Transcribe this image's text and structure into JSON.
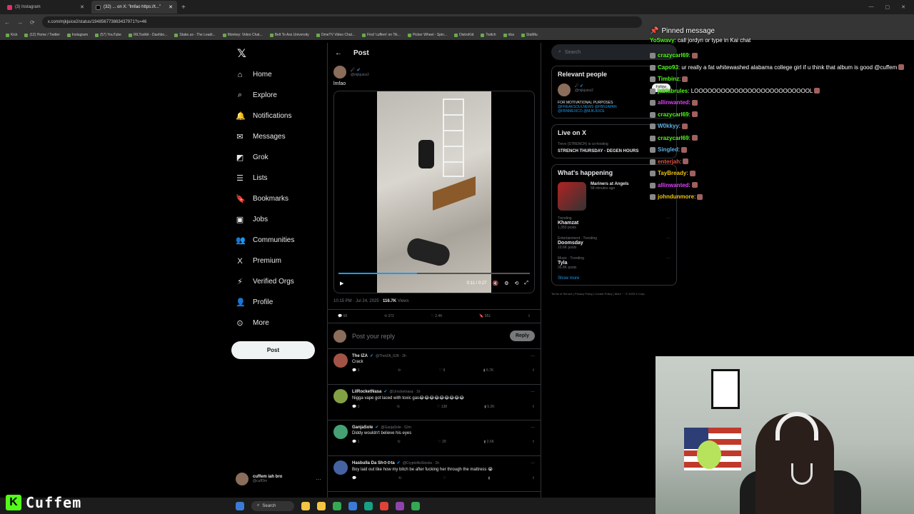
{
  "browser": {
    "tabs": [
      {
        "label": "(3) Instagram",
        "active": false
      },
      {
        "label": "(32) ... on X: \"lmfao https://t...\"",
        "active": true
      }
    ],
    "url": "x.com/mjkjuice2/status/194856773863437971?s=46",
    "bookmarks": [
      "Kick",
      "(12) Home / Twitter",
      "Instagram",
      "(57) YouTube",
      "IRLToolkit - Dashbo...",
      "Stake.us - The Leadi...",
      "Monkey: Video Chat...",
      "Belt To Ass University",
      "OmeTV Video Chat...",
      "Find 'cuffem' on Tik...",
      "Picker Wheel - Spin...",
      "DistroKid",
      "Twitch",
      "nba",
      "StatMu"
    ]
  },
  "nav": {
    "items": [
      {
        "label": "Home",
        "icon": "⌂",
        "name": "home"
      },
      {
        "label": "Explore",
        "icon": "⌕",
        "name": "explore"
      },
      {
        "label": "Notifications",
        "icon": "🔔",
        "name": "notifications"
      },
      {
        "label": "Messages",
        "icon": "✉",
        "name": "messages"
      },
      {
        "label": "Grok",
        "icon": "◩",
        "name": "grok"
      },
      {
        "label": "Lists",
        "icon": "☰",
        "name": "lists"
      },
      {
        "label": "Bookmarks",
        "icon": "🔖",
        "name": "bookmarks"
      },
      {
        "label": "Jobs",
        "icon": "▣",
        "name": "jobs"
      },
      {
        "label": "Communities",
        "icon": "👥",
        "name": "communities"
      },
      {
        "label": "Premium",
        "icon": "X",
        "name": "premium"
      },
      {
        "label": "Verified Orgs",
        "icon": "⚡",
        "name": "verified-orgs"
      },
      {
        "label": "Profile",
        "icon": "👤",
        "name": "profile"
      },
      {
        "label": "More",
        "icon": "⊙",
        "name": "more"
      }
    ],
    "post_label": "Post",
    "account": {
      "name": "cuffem iah bro",
      "handle": "@cuff3m"
    }
  },
  "post": {
    "header": "Post",
    "author_handle": "@mjkjuice2",
    "text": "lmfao",
    "video_time": "0:11 / 0:27",
    "progress": 0.41,
    "timestamp": "10:15 PM · Jul 24, 2025 · ",
    "views_count": "116.7K",
    "views_label": " Views",
    "stats": {
      "replies": "68",
      "reposts": "372",
      "likes": "2.4K",
      "bookmarks": "951"
    },
    "reply_placeholder": "Post your reply",
    "reply_label": "Reply"
  },
  "replies": [
    {
      "name": "The IZA",
      "handle": "@TheIZA_628 · 2h",
      "text": "Crack",
      "r": "3",
      "rt": "",
      "l": "9",
      "v": "6.7K"
    },
    {
      "name": "LilRocketNasa",
      "handle": "@Urocketnasa · 1h",
      "text": "Nigga vape got laced with toxic gas😂😂😂😂😂😂😂😂😂",
      "r": "3",
      "rt": "",
      "l": "138",
      "v": "5.2K"
    },
    {
      "name": "GanjaSole",
      "handle": "@GanjaSole · 52m",
      "text": "Diddy wouldn't believe his eyes",
      "r": "1",
      "rt": "",
      "l": "29",
      "v": "2.6K"
    },
    {
      "name": "Hasbulla Da Sh⚙⚙ta",
      "handle": "@CryptoNoStocks · 1h",
      "text": "Boy laid out like how my bitch be after fucking her through the mattress 😭",
      "r": "",
      "rt": "",
      "l": "",
      "v": ""
    }
  ],
  "sidebar": {
    "search_placeholder": "Search",
    "relevant": {
      "title": "Relevant people",
      "handle": "@mjkjuice2",
      "follow": "Follow",
      "bio": "FOR MOTIVATIONAL PURPOSES",
      "links": [
        "@FREAKSOULNEWS @FBNJAPAN",
        "@FBNMEXICO @MJKJUICE"
      ]
    },
    "live": {
      "title": "Live on X",
      "host": "Trevv (STRENCH) is co-hosting",
      "space": "STRENCH THURSDAY - DEGEN HOURS"
    },
    "happening": {
      "title": "What's happening",
      "featured": {
        "title": "Mariners at Angels",
        "sub": "58 minutes ago"
      },
      "trends": [
        {
          "cat": "Trending",
          "name": "Khamzat",
          "count": "1,350 posts"
        },
        {
          "cat": "Entertainment · Trending",
          "name": "Doomsday",
          "count": "10.6K posts"
        },
        {
          "cat": "Music · Trending",
          "name": "Tyla",
          "count": "36.8K posts"
        }
      ],
      "show_more": "Show more"
    },
    "footer": "Terms of Service | Privacy Policy | Cookie Policy | More ··· © 2025 X Corp."
  },
  "chat": {
    "pinned_title": "Pinned message",
    "pinned_user": "YoSwavy",
    "pinned_text": ": call jordyn or type in Kai chat",
    "messages": [
      {
        "user": "crazycarl69",
        "color": "#53fc18",
        "text": ":"
      },
      {
        "user": "Capo93",
        "color": "#53fc18",
        "text": ": ur really a fat whitewashed alabama college girl if u think that album is good @cuffem"
      },
      {
        "user": "Timbinz",
        "color": "#53fc18",
        "text": ":"
      },
      {
        "user": "jablabrules",
        "color": "#53fc18",
        "text": ": LOOOOOOOOOOOOOOOOOOOOOOOOOOL"
      },
      {
        "user": "allinwanted",
        "color": "#e040fb",
        "text": ":"
      },
      {
        "user": "crazycarl69",
        "color": "#53fc18",
        "text": ":"
      },
      {
        "user": "W0kkyy",
        "color": "#5dade2",
        "text": ":"
      },
      {
        "user": "crazycarl69",
        "color": "#53fc18",
        "text": ":"
      },
      {
        "user": "Singled",
        "color": "#5dade2",
        "text": ":"
      },
      {
        "user": "enterjah",
        "color": "#e74c3c",
        "text": ":"
      },
      {
        "user": "TayBready",
        "color": "#f1c40f",
        "text": ":"
      },
      {
        "user": "allinwanted",
        "color": "#e040fb",
        "text": ":"
      },
      {
        "user": "johndunmore",
        "color": "#f1c40f",
        "text": ":"
      }
    ]
  },
  "taskbar": {
    "search": "Search"
  },
  "overlay": {
    "brand": "Cuffem",
    "k": "K"
  }
}
